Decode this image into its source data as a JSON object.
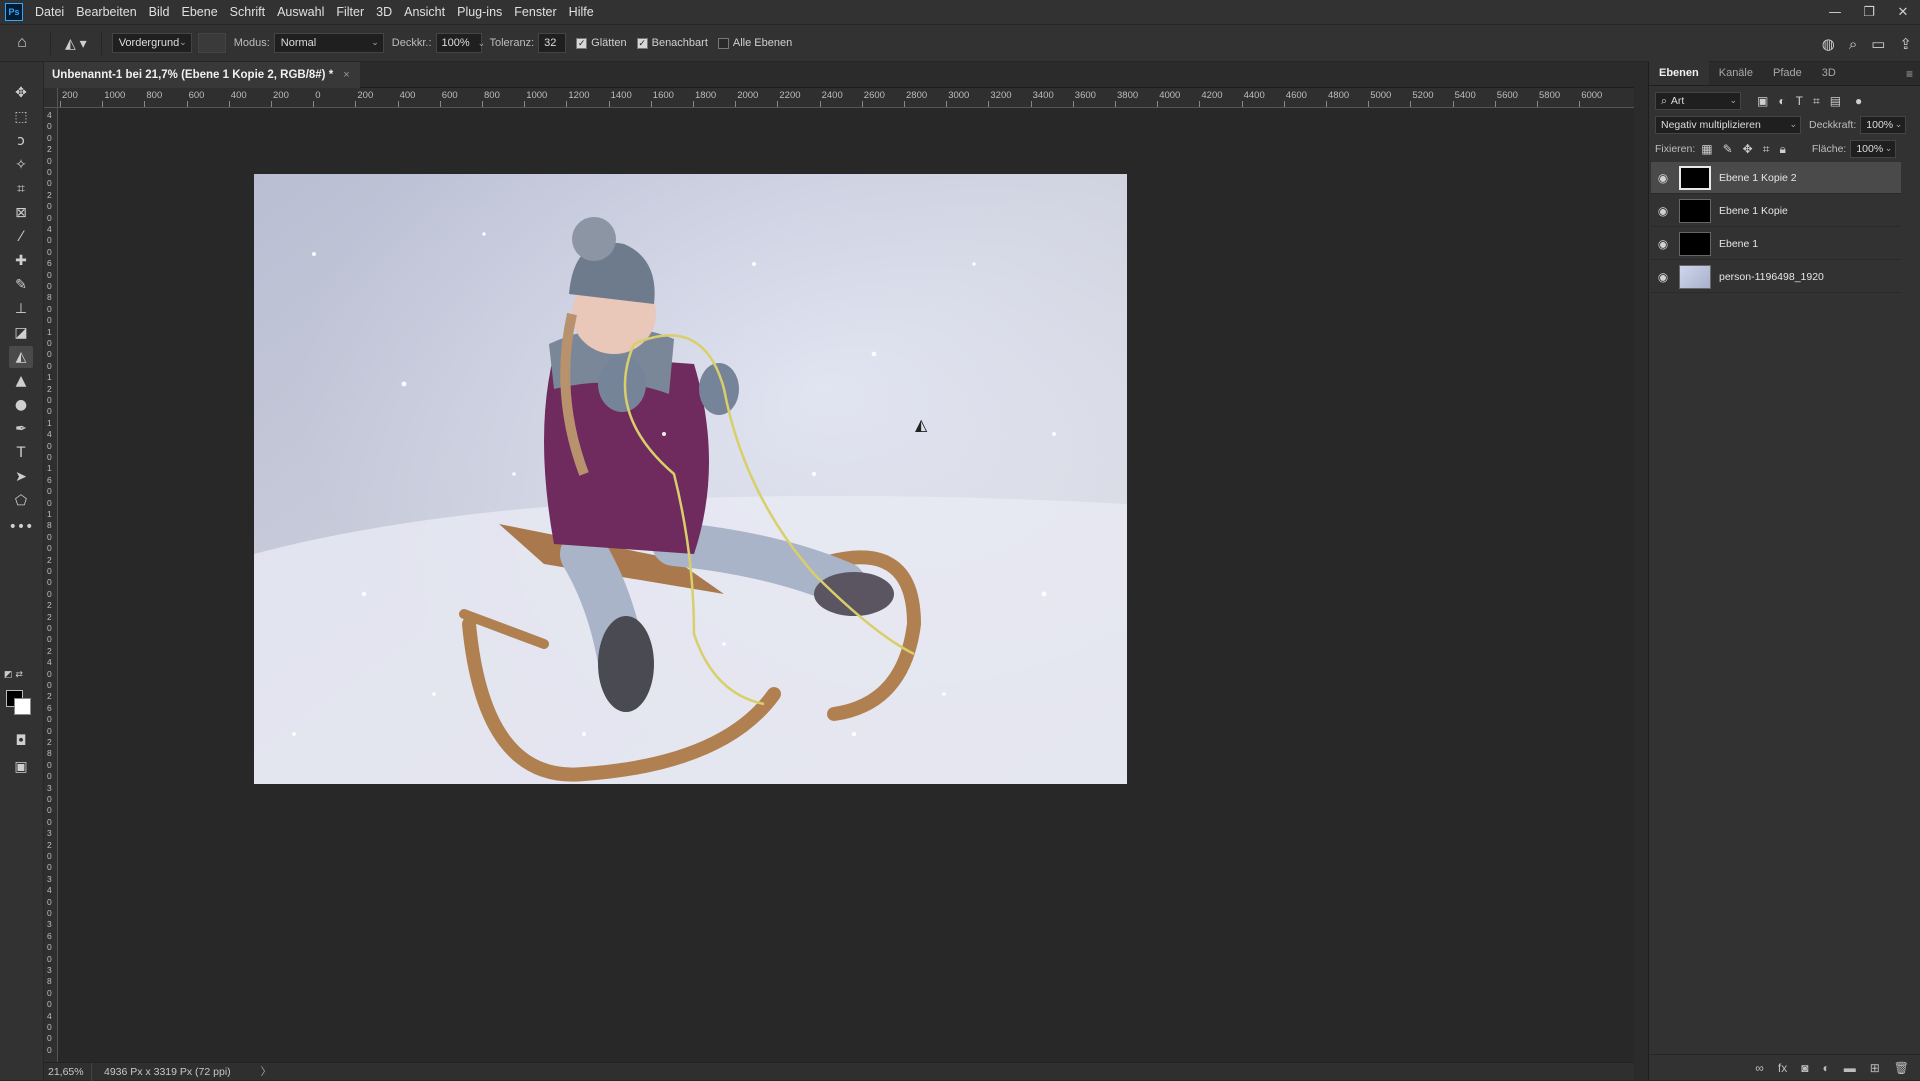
{
  "app": {
    "logo": "Ps"
  },
  "menu": [
    "Datei",
    "Bearbeiten",
    "Bild",
    "Ebene",
    "Schrift",
    "Auswahl",
    "Filter",
    "3D",
    "Ansicht",
    "Plug-ins",
    "Fenster",
    "Hilfe"
  ],
  "window_controls": {
    "minimize": "—",
    "restore": "❐",
    "close": "✕"
  },
  "options": {
    "fill_source": "Vordergrund",
    "mode_label": "Modus:",
    "mode_value": "Normal",
    "opacity_label": "Deckkr.:",
    "opacity_value": "100%",
    "tolerance_label": "Toleranz:",
    "tolerance_value": "32",
    "antialias_label": "Glätten",
    "antialias_checked": true,
    "contiguous_label": "Benachbart",
    "contiguous_checked": true,
    "all_layers_label": "Alle Ebenen",
    "all_layers_checked": false
  },
  "document_tab": {
    "title": "Unbenannt-1 bei 21,7% (Ebene 1 Kopie 2, RGB/8#) *",
    "close": "×"
  },
  "rulers": {
    "horizontal": [
      "200",
      "1000",
      "800",
      "600",
      "400",
      "200",
      "0",
      "200",
      "400",
      "600",
      "800",
      "1000",
      "1200",
      "1400",
      "1600",
      "1800",
      "2000",
      "2200",
      "2400",
      "2600",
      "2800",
      "3000",
      "3200",
      "3400",
      "3600",
      "3800",
      "4000",
      "4200",
      "4400",
      "4600",
      "4800",
      "5000",
      "5200",
      "5400",
      "5600",
      "5800",
      "6000"
    ],
    "vertical": [
      "4",
      "0",
      "0",
      "2",
      "0",
      "0",
      "0",
      "2",
      "0",
      "0",
      "4",
      "0",
      "0",
      "6",
      "0",
      "0",
      "8",
      "0",
      "0",
      "1",
      "0",
      "0",
      "0",
      "1",
      "2",
      "0",
      "0",
      "1",
      "4",
      "0",
      "0",
      "1",
      "6",
      "0",
      "0",
      "1",
      "8",
      "0",
      "0",
      "2",
      "0",
      "0",
      "0",
      "2",
      "2",
      "0",
      "0",
      "2",
      "4",
      "0",
      "0",
      "2",
      "6",
      "0",
      "0",
      "2",
      "8",
      "0",
      "0",
      "3",
      "0",
      "0",
      "0",
      "3",
      "2",
      "0",
      "0",
      "3",
      "4",
      "0",
      "0",
      "3",
      "6",
      "0",
      "0",
      "3",
      "8",
      "0",
      "0",
      "4",
      "0",
      "0",
      "0"
    ]
  },
  "status": {
    "zoom": "21,65%",
    "doc_info": "4936 Px x 3319 Px (72 ppi)",
    "arrow": "〉"
  },
  "panel": {
    "tabs": [
      "Ebenen",
      "Kanäle",
      "Pfade",
      "3D"
    ],
    "active_tab": "Ebenen",
    "filter_label": "Art",
    "blend_mode": "Negativ multiplizieren",
    "opacity_label": "Deckkraft:",
    "opacity_value": "100%",
    "lock_label": "Fixieren:",
    "fill_label": "Fläche:",
    "fill_value": "100%",
    "layers": [
      {
        "name": "Ebene 1 Kopie 2",
        "selected": true
      },
      {
        "name": "Ebene 1 Kopie",
        "selected": false
      },
      {
        "name": "Ebene 1",
        "selected": false
      },
      {
        "name": "person-1196498_1920",
        "selected": false
      }
    ]
  },
  "colors": {
    "accent": "#31a8ff",
    "chrome": "#323232",
    "canvas_bg": "#282828",
    "selected_layer": "#4a4a4a"
  }
}
